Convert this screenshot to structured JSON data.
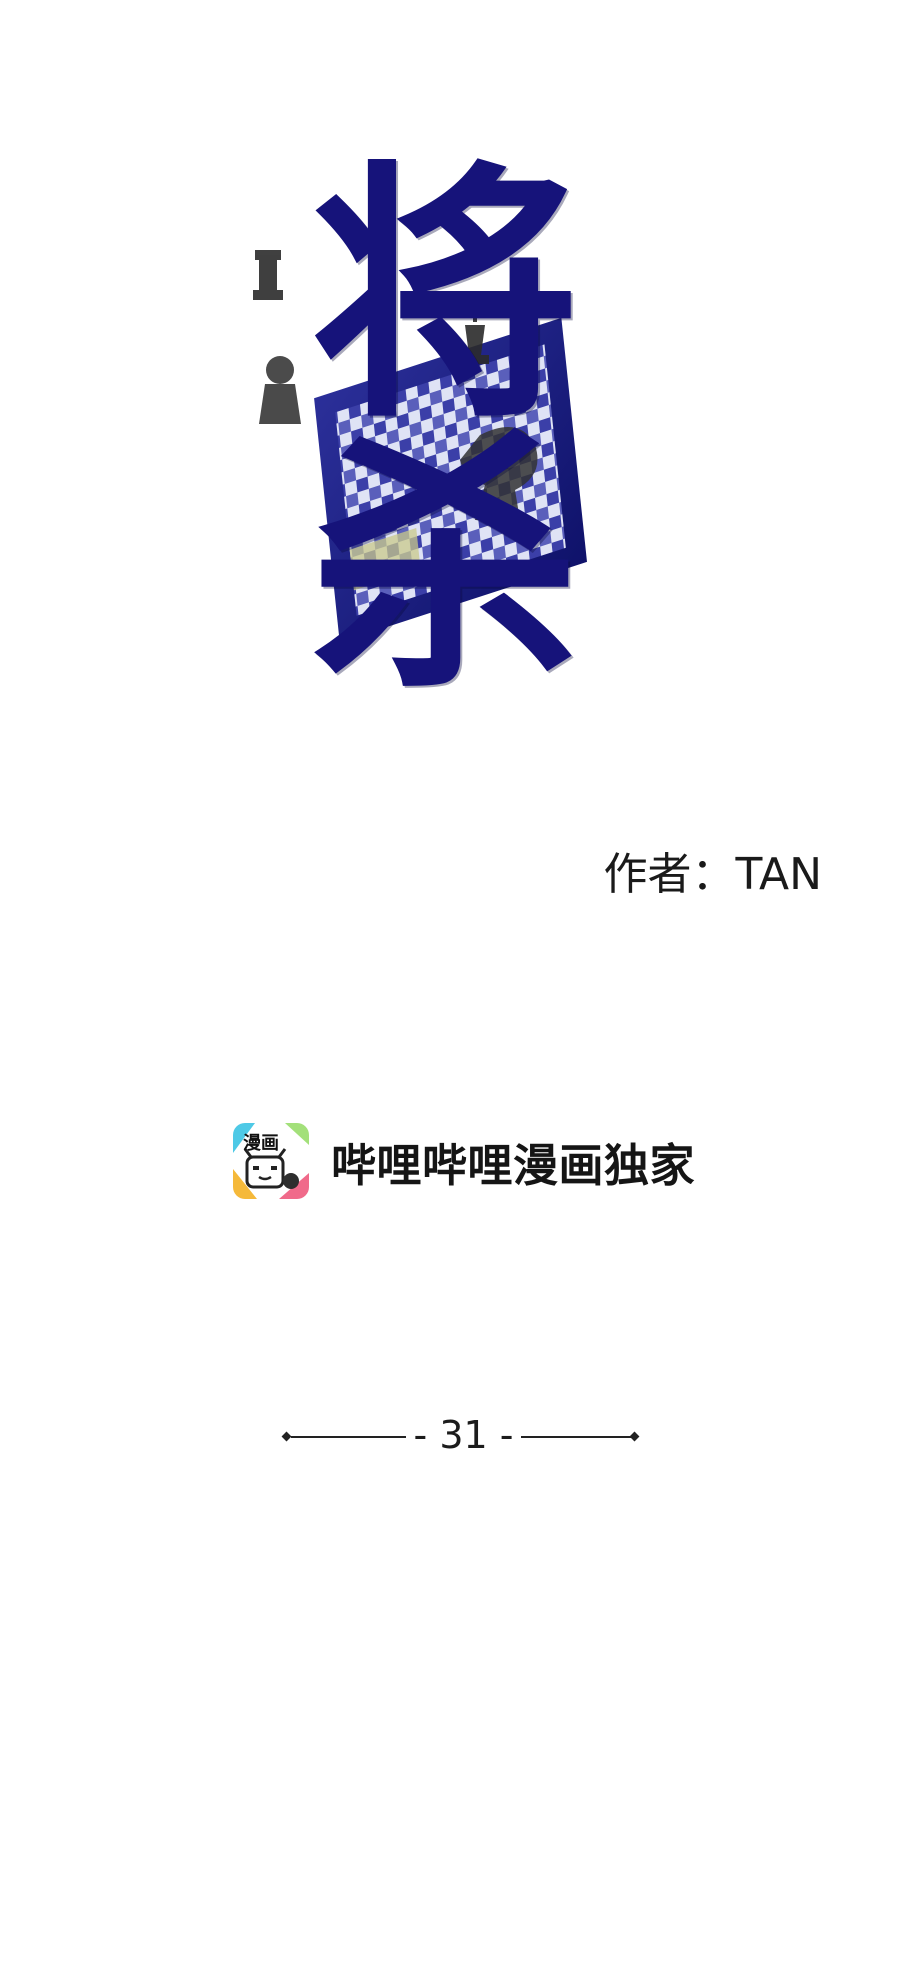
{
  "title": {
    "top_char": "将",
    "bottom_char": "杀",
    "text_color": "#16137a",
    "board_colors": [
      "#2a2fa0",
      "#d8dcf2",
      "#c9c98a"
    ],
    "piece_color": "#2b2b2b"
  },
  "author": {
    "label": "作者：",
    "name": "TAN"
  },
  "platform": {
    "logo_text": "漫画",
    "text": "哔哩哔哩漫画独家"
  },
  "chapter": {
    "number": "31",
    "prefix": "- ",
    "suffix": " -"
  }
}
